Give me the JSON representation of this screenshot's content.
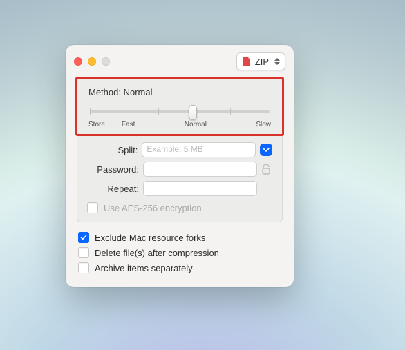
{
  "titlebar": {
    "format_icon": "zip-file-icon",
    "format_label": "ZIP"
  },
  "method": {
    "label": "Method:",
    "value": "Normal",
    "slider_labels": {
      "store": "Store",
      "fast": "Fast",
      "normal": "Normal",
      "slow": "Slow"
    },
    "slider_pos_pct": 57
  },
  "fields": {
    "split": {
      "label": "Split:",
      "placeholder": "Example: 5 MB",
      "value": ""
    },
    "password": {
      "label": "Password:",
      "value": ""
    },
    "repeat": {
      "label": "Repeat:",
      "value": ""
    }
  },
  "aes": {
    "label": "Use AES-256 encryption",
    "checked": false
  },
  "options": {
    "exclude": {
      "label": "Exclude Mac resource forks",
      "checked": true
    },
    "delete": {
      "label": "Delete file(s) after compression",
      "checked": false
    },
    "separate": {
      "label": "Archive items separately",
      "checked": false
    }
  }
}
